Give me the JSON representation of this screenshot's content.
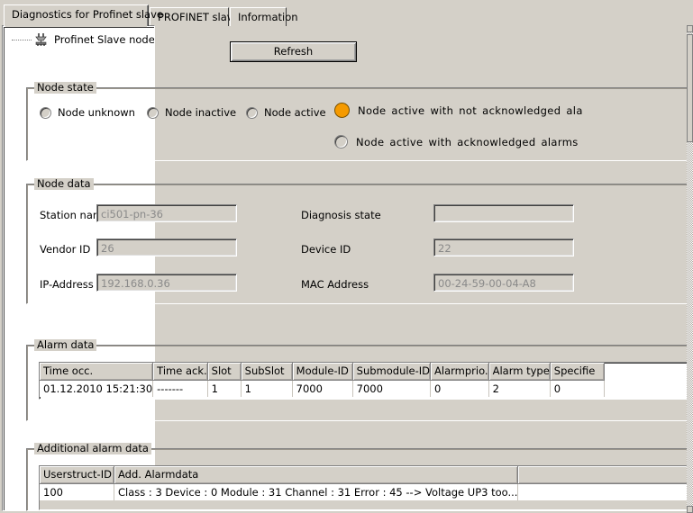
{
  "tabs": [
    {
      "label": "Diagnostics for Profinet slave",
      "active": true
    },
    {
      "label": "PROFINET slave",
      "active": false
    },
    {
      "label": "Information",
      "active": false
    }
  ],
  "tree": {
    "item_label": "Profinet Slave node infor",
    "icon": "profinet-node-icon"
  },
  "toolbar": {
    "refresh_label": "Refresh"
  },
  "node_state": {
    "title": "Node state",
    "options": [
      {
        "label": "Node unknown",
        "checked": false
      },
      {
        "label": "Node inactive",
        "checked": false
      },
      {
        "label": "Node active",
        "checked": false
      },
      {
        "label": "Node  active  with  not  acknowledged  ala",
        "checked": true
      },
      {
        "label": "Node  active  with  acknowledged  alarms",
        "checked": false
      }
    ],
    "selected_color": "#f59a00"
  },
  "node_data": {
    "title": "Node data",
    "fields": [
      {
        "label": "Station name",
        "value": "ci501-pn-36"
      },
      {
        "label": "Vendor ID",
        "value": "26"
      },
      {
        "label": "IP-Address",
        "value": "192.168.0.36"
      },
      {
        "label": "Diagnosis state",
        "value": ""
      },
      {
        "label": "Device ID",
        "value": "22"
      },
      {
        "label": "MAC Address",
        "value": "00-24-59-00-04-A8"
      }
    ]
  },
  "alarm_data": {
    "title": "Alarm data",
    "columns": [
      "Time occ.",
      "Time ack.",
      "Slot",
      "SubSlot",
      "Module-ID",
      "Submodule-ID",
      "Alarmprio.",
      "Alarm type",
      "Specifie"
    ],
    "rows": [
      [
        "01.12.2010 15:21:30",
        "-------",
        "1",
        "1",
        "7000",
        "7000",
        "0",
        "2",
        "0"
      ]
    ]
  },
  "additional_alarm_data": {
    "title": "Additional alarm data",
    "columns": [
      "Userstruct-ID",
      "Add. Alarmdata",
      ""
    ],
    "rows": [
      [
        "100",
        "Class : 3  Device : 0  Module : 31  Channel : 31  Error : 45 --> Voltage UP3 too...",
        ""
      ]
    ]
  },
  "scrollbar": {
    "name": "vertical-scrollbar"
  }
}
